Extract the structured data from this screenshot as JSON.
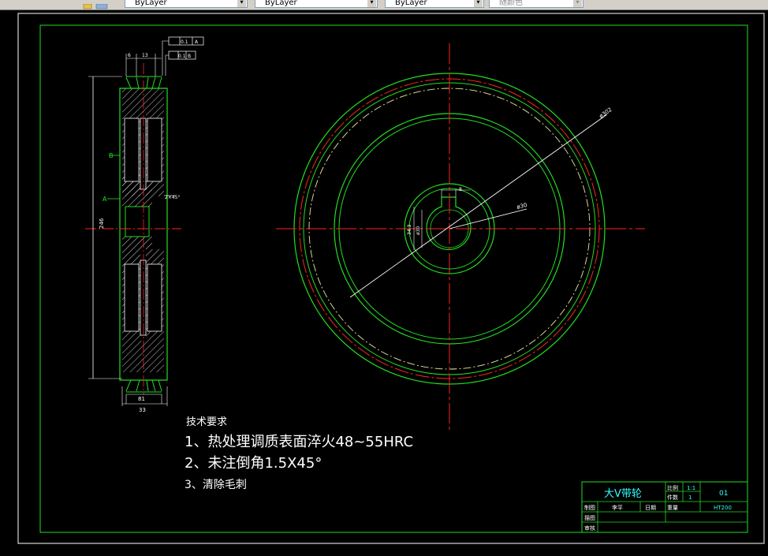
{
  "toolbar": {
    "layer_combo": "ByLayer",
    "linetype_combo": "ByLayer",
    "lineweight_combo": "ByLayer",
    "plotstyle_combo": "随颜色"
  },
  "drawing": {
    "tech_title": "技术要求",
    "tech_items": [
      "1、热处理调质表面淬火48~55HRC",
      "2、未注倒角1.5X45°",
      "3、清除毛刺"
    ],
    "dims": {
      "outer_dia": "ø302",
      "hub_dia": "ø30",
      "height": "246",
      "width_small": "81",
      "width_large": "33",
      "groove_top_a": "6",
      "groove_top_b": "13",
      "chamfer": "2×45°",
      "keyway_width": "8",
      "keyway_depth": "34.3",
      "bore": "ø30",
      "tol_1": "0.1",
      "tol_2": "0.1",
      "tol_ref_a": "A",
      "tol_ref_b": "B",
      "datum_b": "B",
      "datum_a": "A"
    },
    "title_block": {
      "part_name": "大V带轮",
      "scale_label": "比例",
      "scale_value": "1:1",
      "qty_label": "件数",
      "qty_value": "1",
      "drawing_no": "01",
      "material": "HT200",
      "drawn_label": "制图",
      "drawn_name": "李平",
      "date_label": "日期",
      "weight_label": "重量",
      "design_label": "描图",
      "check_label": "审核"
    }
  }
}
